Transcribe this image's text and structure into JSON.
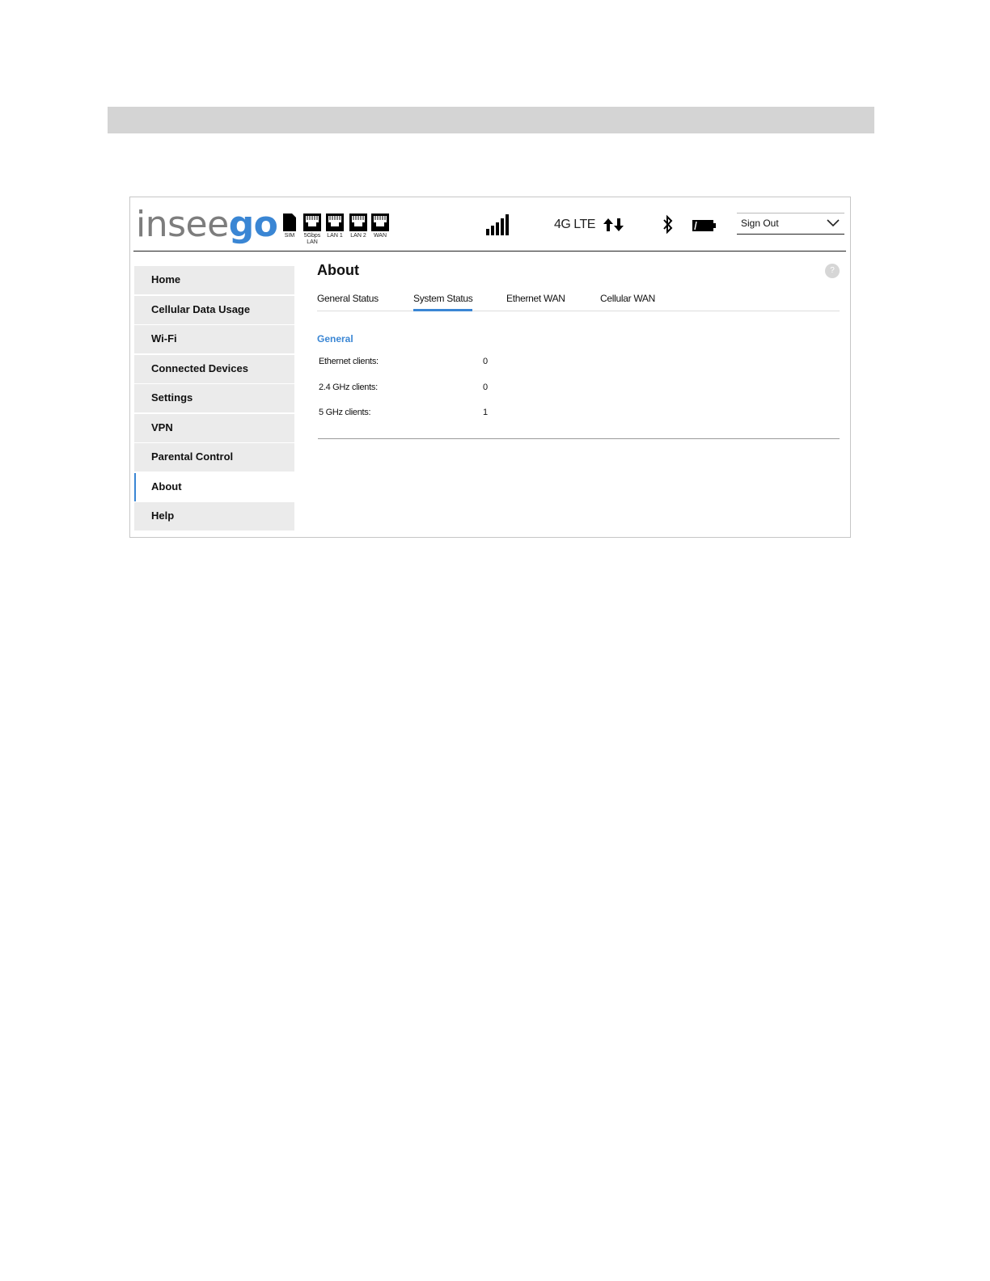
{
  "brand": {
    "prefix": "insee",
    "suffix": "go"
  },
  "status_bar": {
    "ports": [
      {
        "label": "SIM",
        "icon": "sim-card-icon"
      },
      {
        "label": "5Gbps",
        "label2": "LAN",
        "icon": "ethernet-port-icon"
      },
      {
        "label": "LAN 1",
        "icon": "ethernet-port-icon"
      },
      {
        "label": "LAN 2",
        "icon": "ethernet-port-icon"
      },
      {
        "label": "WAN",
        "icon": "ethernet-port-icon"
      }
    ],
    "network_type": "4G LTE",
    "signal_icon": "signal-bars-icon",
    "data_icon": "up-down-arrows-icon",
    "bluetooth_icon": "bluetooth-icon",
    "battery_icon": "battery-icon"
  },
  "account": {
    "signout_label": "Sign Out"
  },
  "sidebar": {
    "items": [
      {
        "label": "Home"
      },
      {
        "label": "Cellular Data Usage"
      },
      {
        "label": "Wi-Fi"
      },
      {
        "label": "Connected Devices"
      },
      {
        "label": "Settings"
      },
      {
        "label": "VPN"
      },
      {
        "label": "Parental Control"
      },
      {
        "label": "About",
        "active": true
      },
      {
        "label": "Help"
      }
    ]
  },
  "main": {
    "title": "About",
    "help_label": "?",
    "tabs": [
      {
        "label": "General Status"
      },
      {
        "label": "System Status",
        "active": true
      },
      {
        "label": "Ethernet WAN"
      },
      {
        "label": "Cellular WAN"
      }
    ],
    "section_title": "General",
    "rows": [
      {
        "label": "Ethernet clients:",
        "value": "0"
      },
      {
        "label": "2.4 GHz clients:",
        "value": "0"
      },
      {
        "label": "5 GHz clients:",
        "value": "1"
      }
    ]
  },
  "colors": {
    "accent": "#3a86d4",
    "nav_bg": "#ebebeb",
    "logo_gray": "#7d7d7d"
  }
}
